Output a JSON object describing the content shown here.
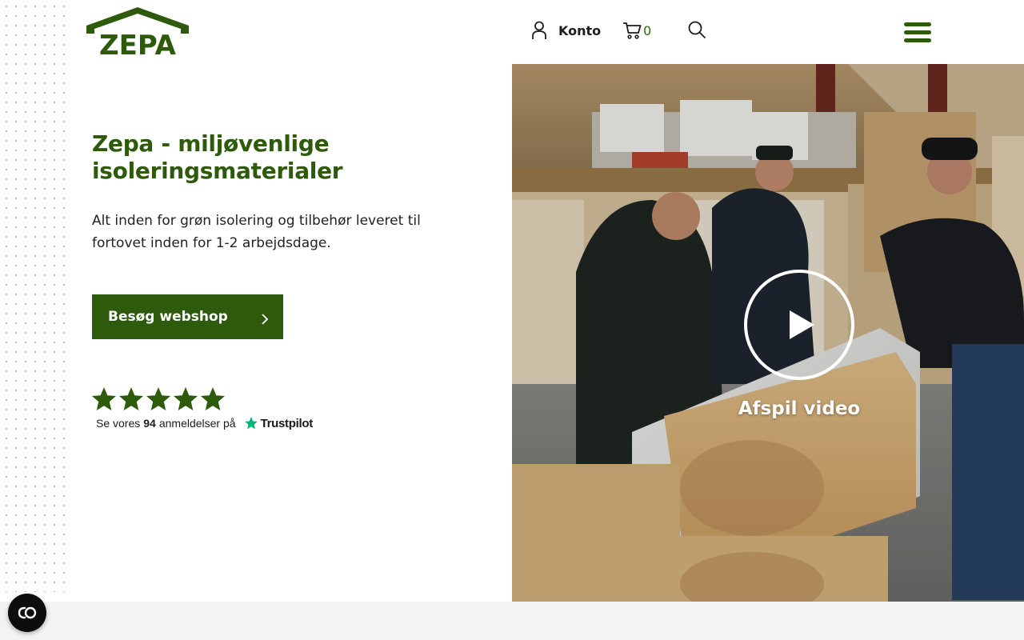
{
  "header": {
    "logo_text": "ZEPA",
    "account_label": "Konto",
    "cart_count": "0"
  },
  "hero": {
    "title": "Zepa - miljøvenlige isoleringsmaterialer",
    "subtitle": "Alt inden for grøn isolering og tilbehør leveret til fortovet inden for 1-2 arbejdsdage.",
    "cta_label": "Besøg webshop"
  },
  "rating": {
    "stars": 5,
    "prefix": "Se vores",
    "count": "94",
    "suffix": "anmeldelser på",
    "provider": "Trustpilot"
  },
  "video": {
    "label": "Afspil video"
  },
  "colors": {
    "brand_green": "#2e5a0c",
    "trustpilot_green": "#00b67a",
    "cart_count_color": "#2f6b12"
  },
  "icons": [
    "user-icon",
    "cart-icon",
    "search-icon",
    "hamburger-menu-icon",
    "chevron-right-icon",
    "star-icon",
    "play-icon",
    "cookie-consent-icon"
  ]
}
